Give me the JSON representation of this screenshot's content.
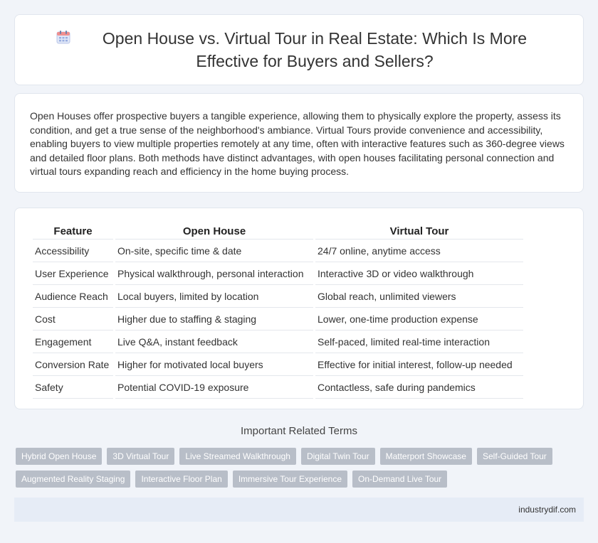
{
  "header": {
    "icon": "calendar-icon",
    "title": "Open House vs. Virtual Tour in Real Estate: Which Is More Effective for Buyers and Sellers?"
  },
  "intro": {
    "text": "Open Houses offer prospective buyers a tangible experience, allowing them to physically explore the property, assess its condition, and get a true sense of the neighborhood's ambiance. Virtual Tours provide convenience and accessibility, enabling buyers to view multiple properties remotely at any time, often with interactive features such as 360-degree views and detailed floor plans. Both methods have distinct advantages, with open houses facilitating personal connection and virtual tours expanding reach and efficiency in the home buying process."
  },
  "table": {
    "headers": [
      "Feature",
      "Open House",
      "Virtual Tour"
    ],
    "rows": [
      [
        "Accessibility",
        "On-site, specific time & date",
        "24/7 online, anytime access"
      ],
      [
        "User Experience",
        "Physical walkthrough, personal interaction",
        "Interactive 3D or video walkthrough"
      ],
      [
        "Audience Reach",
        "Local buyers, limited by location",
        "Global reach, unlimited viewers"
      ],
      [
        "Cost",
        "Higher due to staffing & staging",
        "Lower, one-time production expense"
      ],
      [
        "Engagement",
        "Live Q&A, instant feedback",
        "Self-paced, limited real-time interaction"
      ],
      [
        "Conversion Rate",
        "Higher for motivated local buyers",
        "Effective for initial interest, follow-up needed"
      ],
      [
        "Safety",
        "Potential COVID-19 exposure",
        "Contactless, safe during pandemics"
      ]
    ]
  },
  "related": {
    "title": "Important Related Terms",
    "tags": [
      "Hybrid Open House",
      "3D Virtual Tour",
      "Live Streamed Walkthrough",
      "Digital Twin Tour",
      "Matterport Showcase",
      "Self-Guided Tour",
      "Augmented Reality Staging",
      "Interactive Floor Plan",
      "Immersive Tour Experience",
      "On-Demand Live Tour"
    ]
  },
  "footer": {
    "site": "industrydif.com"
  }
}
